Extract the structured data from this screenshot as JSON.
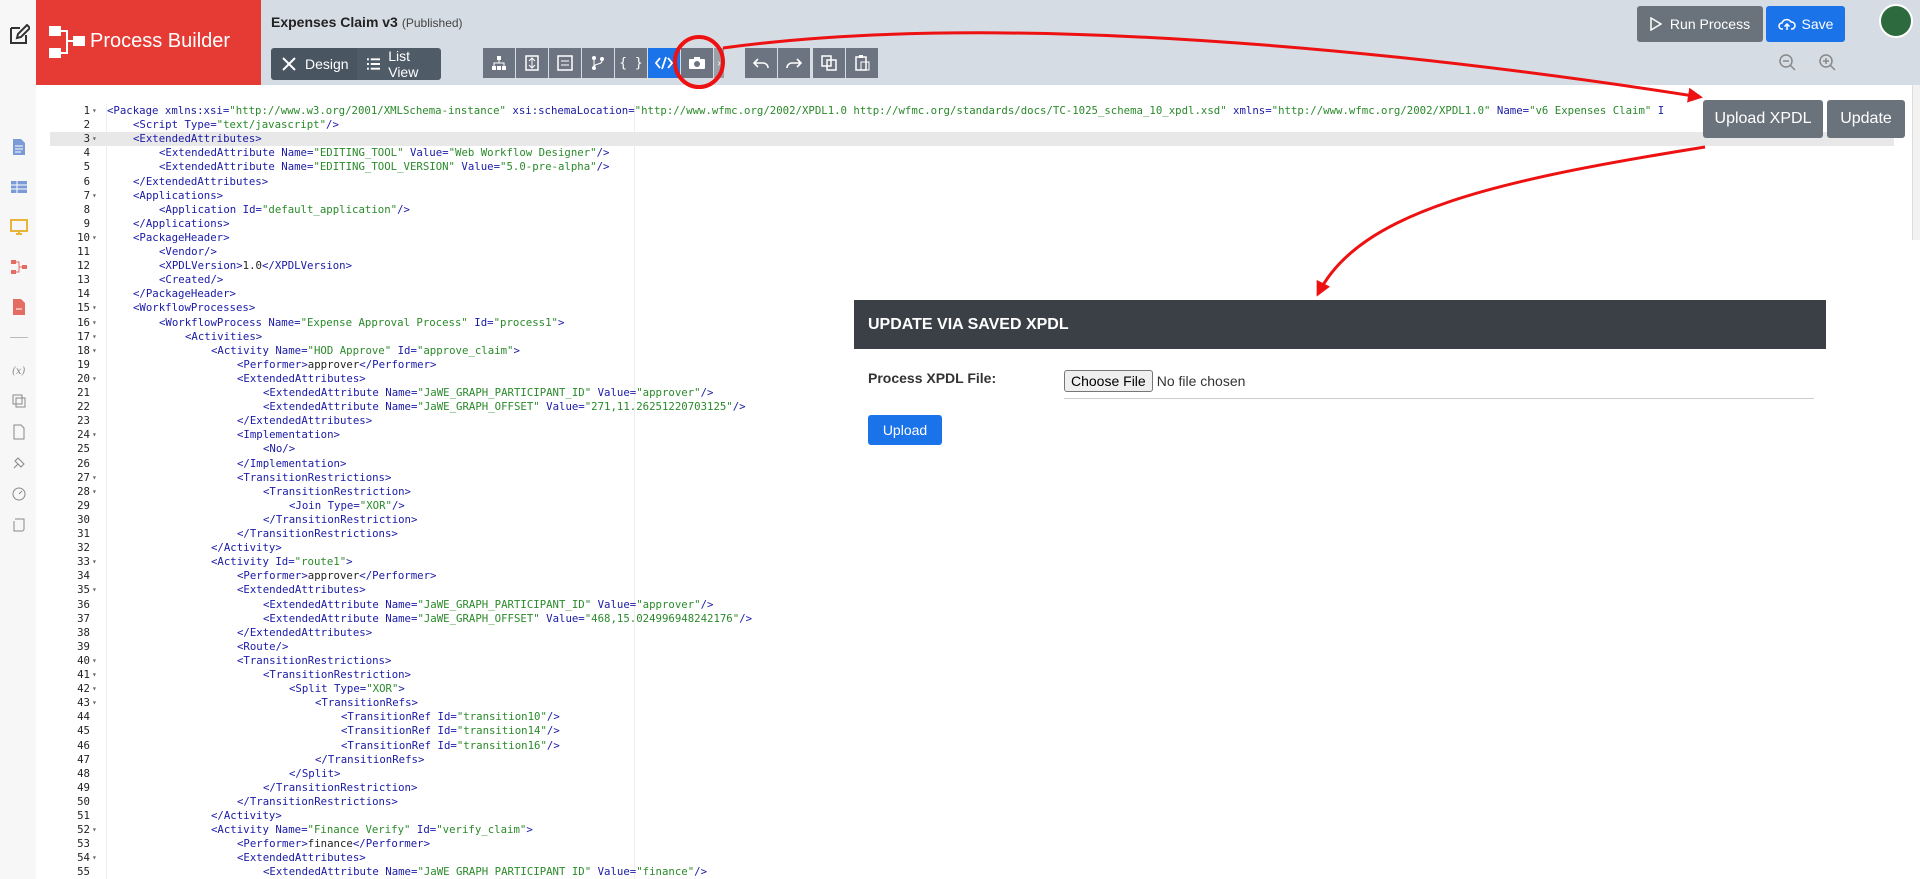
{
  "app": {
    "brand": "Process Builder"
  },
  "header": {
    "title": "Expenses Claim v3",
    "status": "(Published)",
    "design_label": "Design",
    "listview_label": "List View",
    "run_label": "Run Process",
    "save_label": "Save"
  },
  "editor": {
    "upload_xpdl_label": "Upload XPDL",
    "update_label": "Update",
    "lines": [
      {
        "n": "1",
        "f": true,
        "i": 0,
        "code": "<Package xmlns:xsi=\"http://www.w3.org/2001/XMLSchema-instance\" xsi:schemaLocation=\"http://www.wfmc.org/2002/XPDL1.0 http://wfmc.org/standards/docs/TC-1025_schema_10_xpdl.xsd\" xmlns=\"http://www.wfmc.org/2002/XPDL1.0\" Name=\"v6 Expenses Claim\" I"
      },
      {
        "n": "2",
        "f": false,
        "i": 1,
        "code": "<Script Type=\"text/javascript\"/>"
      },
      {
        "n": "3",
        "f": true,
        "i": 1,
        "code": "<ExtendedAttributes>"
      },
      {
        "n": "4",
        "f": false,
        "i": 2,
        "code": "<ExtendedAttribute Name=\"EDITING_TOOL\" Value=\"Web Workflow Designer\"/>"
      },
      {
        "n": "5",
        "f": false,
        "i": 2,
        "code": "<ExtendedAttribute Name=\"EDITING_TOOL_VERSION\" Value=\"5.0-pre-alpha\"/>"
      },
      {
        "n": "6",
        "f": false,
        "i": 1,
        "code": "</ExtendedAttributes>"
      },
      {
        "n": "7",
        "f": true,
        "i": 1,
        "code": "<Applications>"
      },
      {
        "n": "8",
        "f": false,
        "i": 2,
        "code": "<Application Id=\"default_application\"/>"
      },
      {
        "n": "9",
        "f": false,
        "i": 1,
        "code": "</Applications>"
      },
      {
        "n": "10",
        "f": true,
        "i": 1,
        "code": "<PackageHeader>"
      },
      {
        "n": "11",
        "f": false,
        "i": 2,
        "code": "<Vendor/>"
      },
      {
        "n": "12",
        "f": false,
        "i": 2,
        "code": "<XPDLVersion>1.0</XPDLVersion>"
      },
      {
        "n": "13",
        "f": false,
        "i": 2,
        "code": "<Created/>"
      },
      {
        "n": "14",
        "f": false,
        "i": 1,
        "code": "</PackageHeader>"
      },
      {
        "n": "15",
        "f": true,
        "i": 1,
        "code": "<WorkflowProcesses>"
      },
      {
        "n": "16",
        "f": true,
        "i": 2,
        "code": "<WorkflowProcess Name=\"Expense Approval Process\" Id=\"process1\">"
      },
      {
        "n": "17",
        "f": true,
        "i": 3,
        "code": "<Activities>"
      },
      {
        "n": "18",
        "f": true,
        "i": 4,
        "code": "<Activity Name=\"HOD Approve\" Id=\"approve_claim\">"
      },
      {
        "n": "19",
        "f": false,
        "i": 5,
        "code": "<Performer>approver</Performer>"
      },
      {
        "n": "20",
        "f": true,
        "i": 5,
        "code": "<ExtendedAttributes>"
      },
      {
        "n": "21",
        "f": false,
        "i": 6,
        "code": "<ExtendedAttribute Name=\"JaWE_GRAPH_PARTICIPANT_ID\" Value=\"approver\"/>"
      },
      {
        "n": "22",
        "f": false,
        "i": 6,
        "code": "<ExtendedAttribute Name=\"JaWE_GRAPH_OFFSET\" Value=\"271,11.26251220703125\"/>"
      },
      {
        "n": "23",
        "f": false,
        "i": 5,
        "code": "</ExtendedAttributes>"
      },
      {
        "n": "24",
        "f": true,
        "i": 5,
        "code": "<Implementation>"
      },
      {
        "n": "25",
        "f": false,
        "i": 6,
        "code": "<No/>"
      },
      {
        "n": "26",
        "f": false,
        "i": 5,
        "code": "</Implementation>"
      },
      {
        "n": "27",
        "f": true,
        "i": 5,
        "code": "<TransitionRestrictions>"
      },
      {
        "n": "28",
        "f": true,
        "i": 6,
        "code": "<TransitionRestriction>"
      },
      {
        "n": "29",
        "f": false,
        "i": 7,
        "code": "<Join Type=\"XOR\"/>"
      },
      {
        "n": "30",
        "f": false,
        "i": 6,
        "code": "</TransitionRestriction>"
      },
      {
        "n": "31",
        "f": false,
        "i": 5,
        "code": "</TransitionRestrictions>"
      },
      {
        "n": "32",
        "f": false,
        "i": 4,
        "code": "</Activity>"
      },
      {
        "n": "33",
        "f": true,
        "i": 4,
        "code": "<Activity Id=\"route1\">"
      },
      {
        "n": "34",
        "f": false,
        "i": 5,
        "code": "<Performer>approver</Performer>"
      },
      {
        "n": "35",
        "f": true,
        "i": 5,
        "code": "<ExtendedAttributes>"
      },
      {
        "n": "36",
        "f": false,
        "i": 6,
        "code": "<ExtendedAttribute Name=\"JaWE_GRAPH_PARTICIPANT_ID\" Value=\"approver\"/>"
      },
      {
        "n": "37",
        "f": false,
        "i": 6,
        "code": "<ExtendedAttribute Name=\"JaWE_GRAPH_OFFSET\" Value=\"468,15.024996948242176\"/>"
      },
      {
        "n": "38",
        "f": false,
        "i": 5,
        "code": "</ExtendedAttributes>"
      },
      {
        "n": "39",
        "f": false,
        "i": 5,
        "code": "<Route/>"
      },
      {
        "n": "40",
        "f": true,
        "i": 5,
        "code": "<TransitionRestrictions>"
      },
      {
        "n": "41",
        "f": true,
        "i": 6,
        "code": "<TransitionRestriction>"
      },
      {
        "n": "42",
        "f": true,
        "i": 7,
        "code": "<Split Type=\"XOR\">"
      },
      {
        "n": "43",
        "f": true,
        "i": 8,
        "code": "<TransitionRefs>"
      },
      {
        "n": "44",
        "f": false,
        "i": 9,
        "code": "<TransitionRef Id=\"transition10\"/>"
      },
      {
        "n": "45",
        "f": false,
        "i": 9,
        "code": "<TransitionRef Id=\"transition14\"/>"
      },
      {
        "n": "46",
        "f": false,
        "i": 9,
        "code": "<TransitionRef Id=\"transition16\"/>"
      },
      {
        "n": "47",
        "f": false,
        "i": 8,
        "code": "</TransitionRefs>"
      },
      {
        "n": "48",
        "f": false,
        "i": 7,
        "code": "</Split>"
      },
      {
        "n": "49",
        "f": false,
        "i": 6,
        "code": "</TransitionRestriction>"
      },
      {
        "n": "50",
        "f": false,
        "i": 5,
        "code": "</TransitionRestrictions>"
      },
      {
        "n": "51",
        "f": false,
        "i": 4,
        "code": "</Activity>"
      },
      {
        "n": "52",
        "f": true,
        "i": 4,
        "code": "<Activity Name=\"Finance Verify\" Id=\"verify_claim\">"
      },
      {
        "n": "53",
        "f": false,
        "i": 5,
        "code": "<Performer>finance</Performer>"
      },
      {
        "n": "54",
        "f": true,
        "i": 5,
        "code": "<ExtendedAttributes>"
      },
      {
        "n": "55",
        "f": false,
        "i": 6,
        "code": "<ExtendedAttribute Name=\"JaWE GRAPH PARTICIPANT ID\" Value=\"finance\"/>"
      }
    ]
  },
  "dialog": {
    "title": "UPDATE VIA SAVED XPDL",
    "file_label": "Process XPDL File:",
    "choose_label": "Choose File",
    "no_file": "No file chosen",
    "upload_label": "Upload"
  },
  "colors": {
    "brand": "#e53b34",
    "primary": "#1a73e8",
    "annotation": "#ee1111"
  }
}
